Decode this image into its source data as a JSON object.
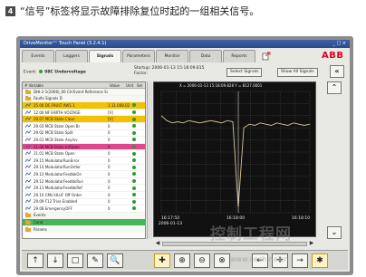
{
  "caption": {
    "number": "4",
    "text": "“信号”标签将显示故障排除复位时起的一组相关信号。"
  },
  "window": {
    "title": "DriveMonitor™ Touch Panel (3.2.4.1)",
    "controls": "_ □ ×"
  },
  "tabs": [
    {
      "label": "Events",
      "active": false
    },
    {
      "label": "Loggers",
      "active": false
    },
    {
      "label": "Signals",
      "active": true
    },
    {
      "label": "Parameters",
      "active": false
    },
    {
      "label": "Monitor",
      "active": false
    },
    {
      "label": "Data",
      "active": false
    },
    {
      "label": "Reports",
      "active": false
    }
  ],
  "brand": {
    "logo_text": "ABB",
    "color": "#e2001a"
  },
  "event_bar": {
    "label": "Event:",
    "value": "08C Undervoltage",
    "meta_line1": "Startup:   2006-01-13 15:18:09.815",
    "meta_line2": "Factor:",
    "btn_select_signals": "Select Signals",
    "btn_show_all": "Show All Signals"
  },
  "signal_list": {
    "headers": [
      "# Variable",
      "Value",
      "Unit",
      "Sel"
    ],
    "rows": [
      {
        "icon": "group",
        "name": "DHI-2-1(2006)_06 CH Event Reference Signal",
        "value": "",
        "highlight": "",
        "mark": ""
      },
      {
        "icon": "folder",
        "name": "Faults Signals D",
        "value": "",
        "highlight": "",
        "mark": ""
      },
      {
        "icon": "signal",
        "name": "25.00 DC FAULT AW1.1",
        "value": "1.11.008.021",
        "highlight": "#f2c200",
        "mark": "#2e9b2e"
      },
      {
        "icon": "signal",
        "name": "12.00 NF EARTH VOLTAGE",
        "value": "[V]",
        "highlight": "",
        "mark": "#2e9b2e"
      },
      {
        "icon": "signal",
        "name": "29.07 MCB State Clear",
        "value": "[V]",
        "highlight": "#f2c200",
        "mark": "#2e9b2e"
      },
      {
        "icon": "signal",
        "name": "29.03 MCB State Open Br",
        "value": "0",
        "highlight": "",
        "mark": "#2e9b2e"
      },
      {
        "icon": "signal",
        "name": "29.02 MCB State Split",
        "value": "0",
        "highlight": "",
        "mark": "#2e9b2e"
      },
      {
        "icon": "signal",
        "name": "29.01 MCB State AnyInv",
        "value": "0",
        "highlight": "",
        "mark": "#2e9b2e"
      },
      {
        "icon": "signal",
        "name": "21.00 MCB State IrdOpen",
        "value": "0",
        "highlight": "#e0478c",
        "mark": "#2e9b2e"
      },
      {
        "icon": "signal",
        "name": "21.01 MCB State Open",
        "value": "0",
        "highlight": "",
        "mark": "#2e9b2e"
      },
      {
        "icon": "signal",
        "name": "29.15 ModulatorRunError",
        "value": "0",
        "highlight": "",
        "mark": "#2e9b2e"
      },
      {
        "icon": "signal",
        "name": "29.14 ModulatorRunOrder",
        "value": "0",
        "highlight": "",
        "mark": "#2e9b2e"
      },
      {
        "icon": "signal",
        "name": "29.13 ModulatorFeedbkOn",
        "value": "0",
        "highlight": "",
        "mark": "#2e9b2e"
      },
      {
        "icon": "signal",
        "name": "29.12 ModulatorFeedbkRun",
        "value": "0",
        "highlight": "",
        "mark": "#2e9b2e"
      },
      {
        "icon": "signal",
        "name": "29.11 ModulatorFeedbkRef",
        "value": "0",
        "highlight": "",
        "mark": "#2e9b2e"
      },
      {
        "icon": "signal",
        "name": "29.10 CMU HLUF Off Order",
        "value": "0",
        "highlight": "",
        "mark": "#2e9b2e"
      },
      {
        "icon": "signal",
        "name": "29.09 F12 Trise Enabled",
        "value": "0",
        "highlight": "",
        "mark": "#2e9b2e"
      },
      {
        "icon": "signal",
        "name": "29.08 EmergencyOFF",
        "value": "0",
        "highlight": "",
        "mark": "#2e9b2e"
      },
      {
        "icon": "folder",
        "name": "Events",
        "value": "",
        "highlight": "",
        "mark": ""
      },
      {
        "icon": "folder",
        "name": "Cond",
        "value": "",
        "highlight": "#45b55a",
        "mark": ""
      },
      {
        "icon": "folder",
        "name": "Params",
        "value": "",
        "highlight": "",
        "mark": ""
      }
    ]
  },
  "chart": {
    "header": "X = 2006-01-13 15:18:09.828   Y = 8127.0001",
    "xticks": [
      "16:17:50",
      "16:18:00",
      "16:18:10"
    ],
    "xlabel_date": "2006-01-13",
    "colors": {
      "line": "#d9c49a",
      "cursor": "#ffffff",
      "bg": "#111111",
      "grid": "#5a5a5a"
    }
  },
  "chart_data": {
    "type": "line",
    "series": [
      {
        "values": [
          0.8,
          0.76,
          0.74,
          0.75,
          0.74,
          0.76,
          0.75,
          0.74,
          0.75,
          0.76,
          0.75,
          0.74,
          0.76,
          0.75,
          0.05,
          0.7,
          0.73,
          0.72,
          0.74,
          0.73,
          0.72,
          0.74,
          0.73,
          0.72,
          0.74,
          0.73,
          0.72,
          0.73
        ]
      }
    ],
    "ylim": [
      0,
      1
    ],
    "grid": true
  },
  "toolbar_left": [
    {
      "name": "move-up-button",
      "glyph": "↑"
    },
    {
      "name": "move-down-button",
      "glyph": "↓"
    },
    {
      "name": "select-box-button",
      "glyph": "□"
    },
    {
      "name": "edit-button",
      "glyph": "✎"
    },
    {
      "name": "search-button",
      "glyph": "🔍"
    }
  ],
  "toolbar_right": [
    {
      "name": "crosshair-button",
      "glyph": "✚",
      "active": true
    },
    {
      "name": "zoom-in-button",
      "glyph": "⊕",
      "active": false
    },
    {
      "name": "zoom-out-button",
      "glyph": "⊖",
      "active": false
    },
    {
      "name": "zoom-fit-button",
      "glyph": "⊗",
      "active": false
    },
    {
      "name": "pan-left-button",
      "glyph": "←",
      "active": false
    },
    {
      "name": "pan-center-button",
      "glyph": "✛",
      "active": false
    },
    {
      "name": "pan-right-button",
      "glyph": "→",
      "active": false
    },
    {
      "name": "note-button",
      "glyph": "✱",
      "active": true
    }
  ],
  "watermark": {
    "text": "控制工程网",
    "url": "www.cechina.cn"
  }
}
